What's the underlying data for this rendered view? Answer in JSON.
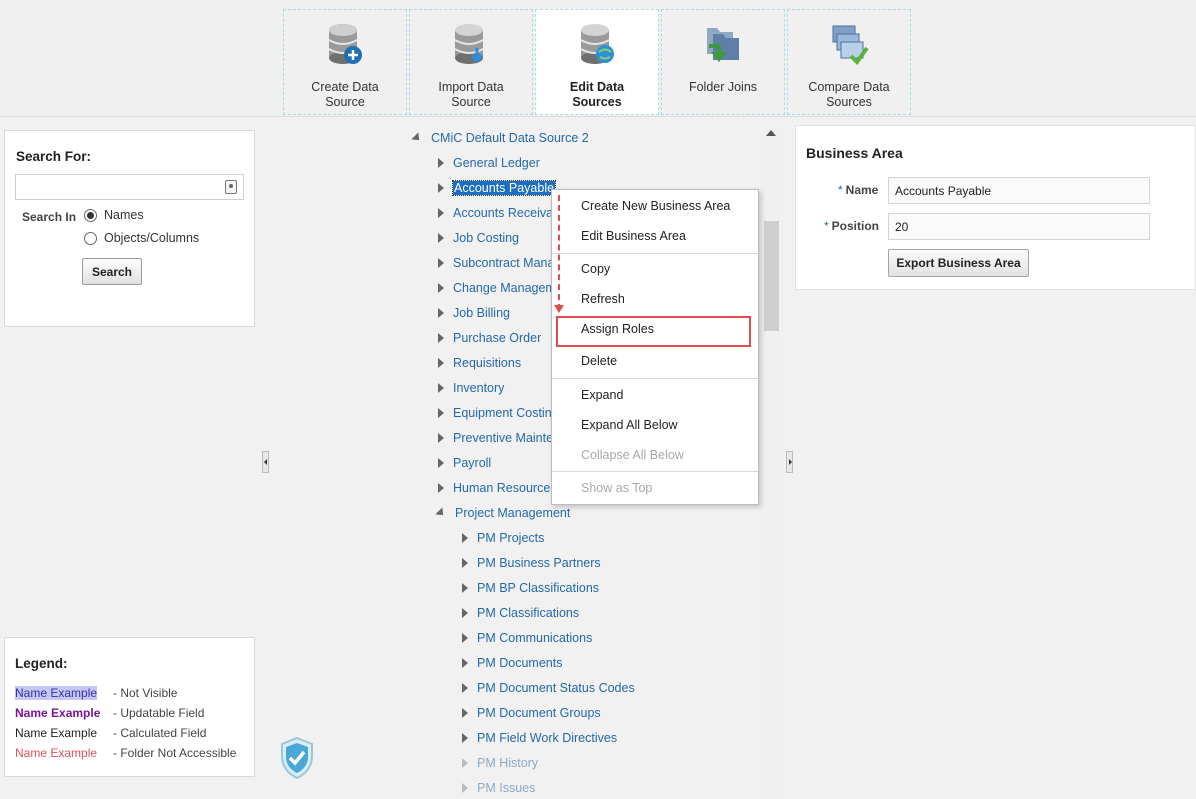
{
  "toolbar": {
    "items": [
      {
        "label_line1": "Create Data",
        "label_line2": "Source",
        "icon": "database-add-icon",
        "active": false
      },
      {
        "label_line1": "Import Data",
        "label_line2": "Source",
        "icon": "database-import-icon",
        "active": false
      },
      {
        "label_line1": "Edit Data",
        "label_line2": "Sources",
        "icon": "database-edit-icon",
        "active": true
      },
      {
        "label_line1": "Folder Joins",
        "label_line2": "",
        "icon": "folder-joins-icon",
        "active": false
      },
      {
        "label_line1": "Compare Data",
        "label_line2": "Sources",
        "icon": "compare-sources-icon",
        "active": false
      }
    ]
  },
  "search": {
    "title": "Search For:",
    "input_value": "",
    "search_in_label": "Search In",
    "options": [
      "Names",
      "Objects/Columns"
    ],
    "selected_option": "Names",
    "button_label": "Search"
  },
  "legend": {
    "title": "Legend:",
    "rows": [
      {
        "name": "Name Example",
        "desc": "- Not Visible"
      },
      {
        "name": "Name Example",
        "desc": "- Updatable Field"
      },
      {
        "name": "Name Example",
        "desc": "- Calculated Field"
      },
      {
        "name": "Name Example",
        "desc": "- Folder Not Accessible"
      }
    ]
  },
  "tree": {
    "root": "CMiC Default Data Source 2",
    "items": [
      "General Ledger",
      "Accounts Payable",
      "Accounts Receival",
      "Job Costing",
      "Subcontract Mana",
      "Change Managem",
      "Job Billing",
      "Purchase Order",
      "Requisitions",
      "Inventory",
      "Equipment Costin",
      "Preventive Mainter",
      "Payroll",
      "Human Resource",
      "Project Management"
    ],
    "selected": "Accounts Payable",
    "children": [
      "PM Projects",
      "PM Business Partners",
      "PM BP Classifications",
      "PM Classifications",
      "PM Communications",
      "PM Documents",
      "PM Document Status Codes",
      "PM Document Groups",
      "PM Field Work Directives",
      "PM History",
      "PM Issues"
    ]
  },
  "context_menu": {
    "items": [
      "Create New Business Area",
      "Edit Business Area",
      "Copy",
      "Refresh",
      "Assign Roles",
      "Delete",
      "Expand",
      "Expand All Below",
      "Collapse All Below",
      "Show as Top"
    ],
    "highlighted": "Assign Roles",
    "disabled": [
      "Collapse All Below",
      "Show as Top"
    ]
  },
  "business_area": {
    "title": "Business Area",
    "name_label": "Name",
    "name_value": "Accounts Payable",
    "position_label": "Position",
    "position_value": "20",
    "required_marker": "*",
    "export_button": "Export Business Area"
  },
  "colors": {
    "link": "#2469a8",
    "selection": "#1c6ec0",
    "highlight_box": "#e34c4c",
    "updatable": "#7a1495",
    "not_accessible": "#e0525a"
  }
}
